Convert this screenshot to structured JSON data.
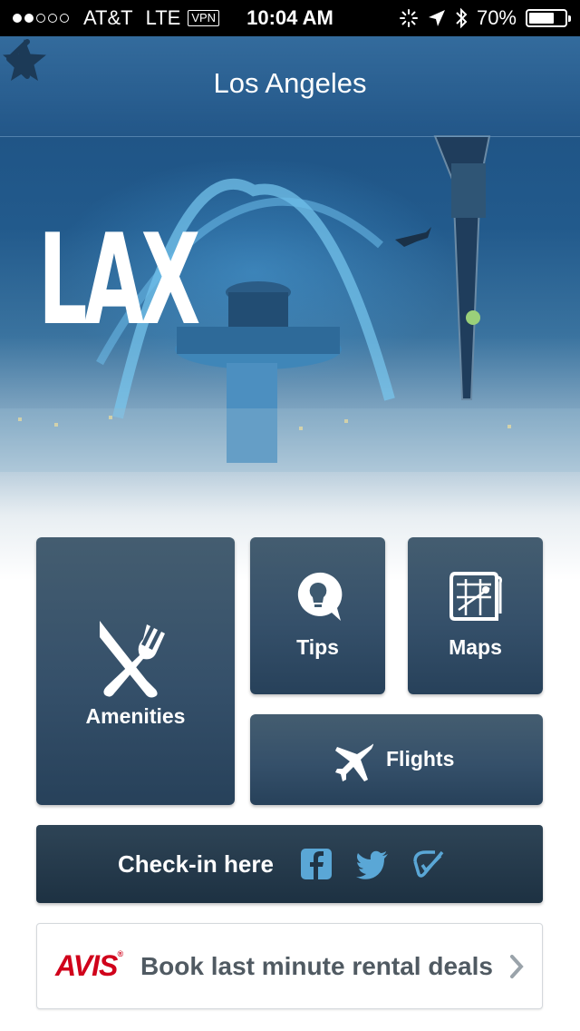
{
  "status_bar": {
    "carrier": "AT&T",
    "network": "LTE",
    "vpn": "VPN",
    "time": "10:04 AM",
    "battery": "70%",
    "battery_level": 0.7,
    "signal_bars": 2
  },
  "nav": {
    "title": "Los Angeles"
  },
  "hero": {
    "airport_code": "LAX"
  },
  "tiles": {
    "amenities": "Amenities",
    "tips": "Tips",
    "maps": "Maps",
    "flights": "Flights"
  },
  "checkin": {
    "label": "Check-in here"
  },
  "ad": {
    "brand": "AVIS",
    "text": "Book last minute rental deals"
  },
  "colors": {
    "tile": "#35506a",
    "avis_red": "#d0021b"
  }
}
